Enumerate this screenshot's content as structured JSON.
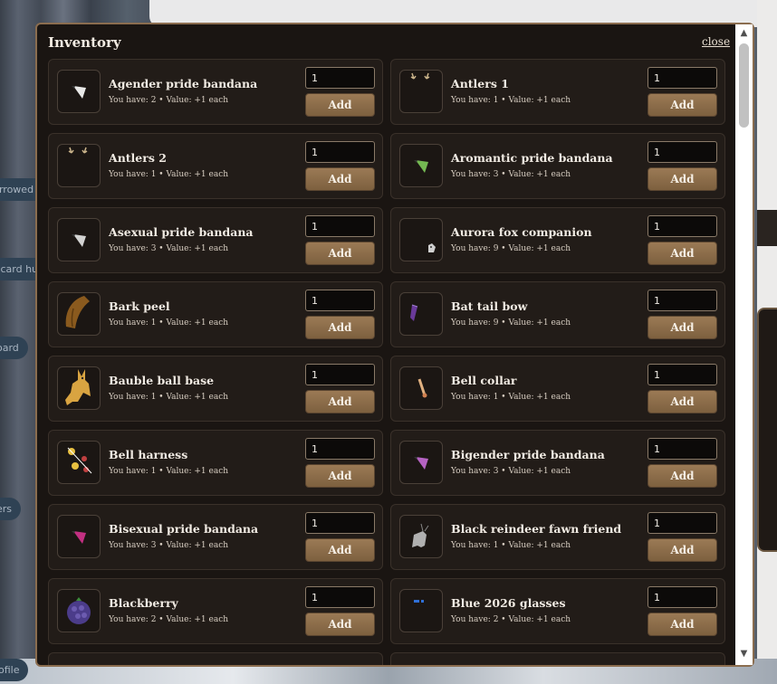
{
  "background": {
    "pills": [
      "urrowed W",
      "g card hu",
      "oard",
      "ers",
      "ofile"
    ]
  },
  "inventory": {
    "title": "Inventory",
    "close_label": "close",
    "add_label": "Add",
    "items": [
      {
        "name": "Agender pride bandana",
        "meta": "You have: 2 • Value: +1 each",
        "qty": "1",
        "icon": "bandana-icon",
        "color": "#ffffff"
      },
      {
        "name": "Antlers 1",
        "meta": "You have: 1 • Value: +1 each",
        "qty": "1",
        "icon": "antlers-icon",
        "color": "#c9b38a"
      },
      {
        "name": "Antlers 2",
        "meta": "You have: 1 • Value: +1 each",
        "qty": "1",
        "icon": "antlers-icon",
        "color": "#c9b38a"
      },
      {
        "name": "Aromantic pride bandana",
        "meta": "You have: 3 • Value: +1 each",
        "qty": "1",
        "icon": "bandana-icon",
        "color": "#7ecb5a"
      },
      {
        "name": "Asexual pride bandana",
        "meta": "You have: 3 • Value: +1 each",
        "qty": "1",
        "icon": "bandana-icon",
        "color": "#e8e8e8"
      },
      {
        "name": "Aurora fox companion",
        "meta": "You have: 9 • Value: +1 each",
        "qty": "1",
        "icon": "fox-icon",
        "color": "#d0d0d0"
      },
      {
        "name": "Bark peel",
        "meta": "You have: 1 • Value: +1 each",
        "qty": "1",
        "icon": "bark-icon",
        "color": "#8a5a1e"
      },
      {
        "name": "Bat tail bow",
        "meta": "You have: 9 • Value: +1 each",
        "qty": "1",
        "icon": "bow-icon",
        "color": "#6a3a9a"
      },
      {
        "name": "Bauble ball base",
        "meta": "You have: 1 • Value: +1 each",
        "qty": "1",
        "icon": "golden-fox-icon",
        "color": "#d9a441"
      },
      {
        "name": "Bell collar",
        "meta": "You have: 1 • Value: +1 each",
        "qty": "1",
        "icon": "collar-icon",
        "color": "#e0b080"
      },
      {
        "name": "Bell harness",
        "meta": "You have: 1 • Value: +1 each",
        "qty": "1",
        "icon": "harness-icon",
        "color": "#e8c040"
      },
      {
        "name": "Bigender pride bandana",
        "meta": "You have: 3 • Value: +1 each",
        "qty": "1",
        "icon": "bandana-icon",
        "color": "#c76bd6"
      },
      {
        "name": "Bisexual pride bandana",
        "meta": "You have: 3 • Value: +1 each",
        "qty": "1",
        "icon": "bandana-icon",
        "color": "#d6338f"
      },
      {
        "name": "Black reindeer fawn friend",
        "meta": "You have: 1 • Value: +1 each",
        "qty": "1",
        "icon": "reindeer-icon",
        "color": "#b0b0b0"
      },
      {
        "name": "Blackberry",
        "meta": "You have: 2 • Value: +1 each",
        "qty": "1",
        "icon": "blackberry-icon",
        "color": "#4b3c8a"
      },
      {
        "name": "Blue 2026 glasses",
        "meta": "You have: 2 • Value: +1 each",
        "qty": "1",
        "icon": "glasses-icon",
        "color": "#2f6fd6"
      }
    ]
  }
}
